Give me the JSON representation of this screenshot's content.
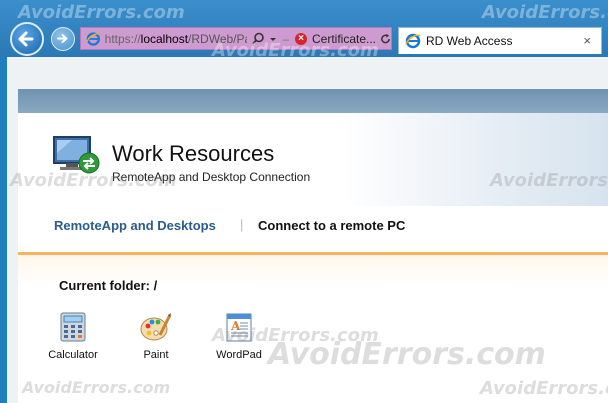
{
  "browser": {
    "address": {
      "scheme": "https://",
      "host": "localhost",
      "path": "/RDWeb/Pa",
      "cert_error": "Certificate..."
    },
    "tab": {
      "title": "RD Web Access",
      "close": "×"
    }
  },
  "header": {
    "title": "Work Resources",
    "subtitle": "RemoteApp and Desktop Connection"
  },
  "nav": {
    "item1": "RemoteApp and Desktops",
    "separator": "|",
    "item2": "Connect to a remote PC"
  },
  "folder": {
    "label": "Current folder: /"
  },
  "apps": [
    {
      "label": "Calculator",
      "icon": "calculator-icon"
    },
    {
      "label": "Paint",
      "icon": "paint-icon"
    },
    {
      "label": "WordPad",
      "icon": "wordpad-icon"
    }
  ],
  "watermark": "AvoidErrors.com",
  "colors": {
    "nav_accent": "#f4b35d",
    "link_blue": "#2a5c8c",
    "address_highlight": "#ce9bd0"
  }
}
